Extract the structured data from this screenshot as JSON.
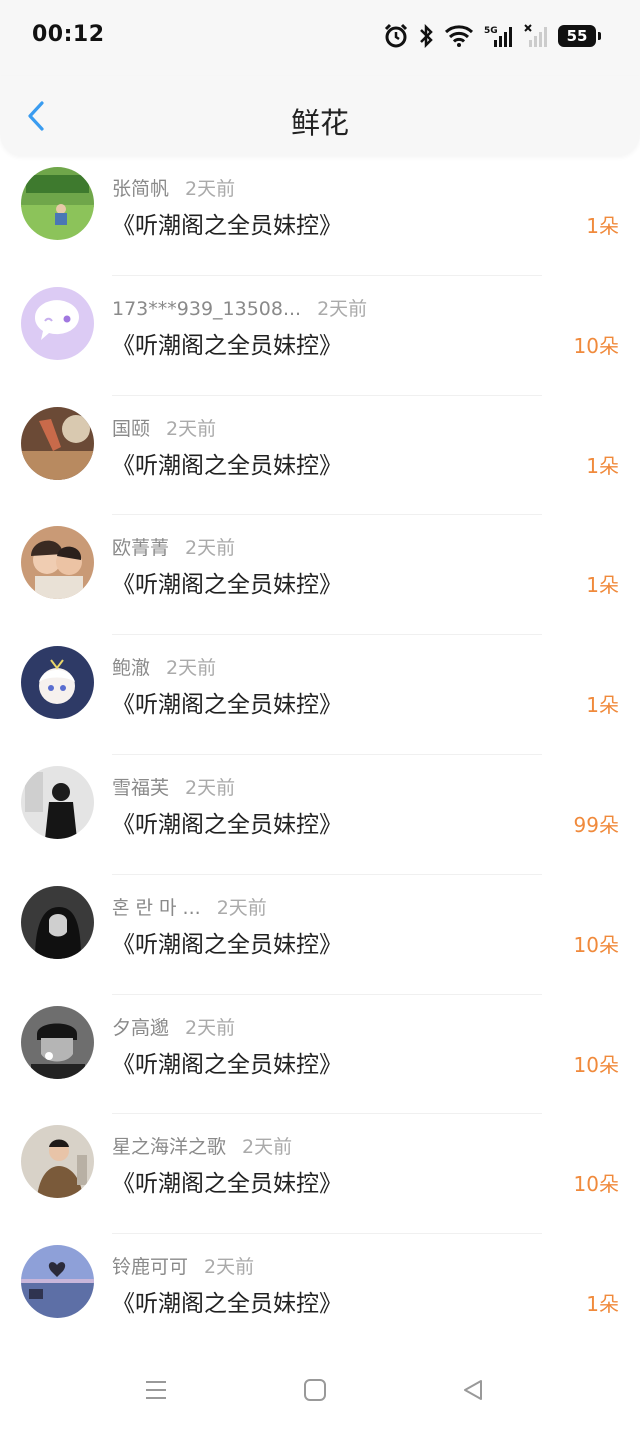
{
  "status_bar": {
    "time": "00:12",
    "battery": "55",
    "icons": [
      "alarm-icon",
      "bluetooth-icon",
      "wifi-icon",
      "5g-signal-icon",
      "signal-off-icon",
      "battery-icon"
    ]
  },
  "header": {
    "title": "鲜花",
    "back_icon": "chevron-left-icon",
    "accent_color": "#3a9cf0"
  },
  "list": {
    "count_color": "#f08a3c",
    "items": [
      {
        "name": "张简帆",
        "time": "2天前",
        "book": "《听潮阁之全员妹控》",
        "count": "1朵"
      },
      {
        "name": "173***939_13508...",
        "time": "2天前",
        "book": "《听潮阁之全员妹控》",
        "count": "10朵"
      },
      {
        "name": "国颐",
        "time": "2天前",
        "book": "《听潮阁之全员妹控》",
        "count": "1朵"
      },
      {
        "name": "欧菁菁",
        "time": "2天前",
        "book": "《听潮阁之全员妹控》",
        "count": "1朵"
      },
      {
        "name": "鲍澈",
        "time": "2天前",
        "book": "《听潮阁之全员妹控》",
        "count": "1朵"
      },
      {
        "name": "雪福芙",
        "time": "2天前",
        "book": "《听潮阁之全员妹控》",
        "count": "99朵"
      },
      {
        "name": "혼 란 마 ...",
        "time": "2天前",
        "book": "《听潮阁之全员妹控》",
        "count": "10朵"
      },
      {
        "name": "夕高邈",
        "time": "2天前",
        "book": "《听潮阁之全员妹控》",
        "count": "10朵"
      },
      {
        "name": "星之海洋之歌",
        "time": "2天前",
        "book": "《听潮阁之全员妹控》",
        "count": "10朵"
      },
      {
        "name": "铃鹿可可",
        "time": "2天前",
        "book": "《听潮阁之全员妹控》",
        "count": "1朵"
      }
    ]
  },
  "nav_bar": {
    "icons": [
      "menu-icon",
      "home-square-icon",
      "back-triangle-icon"
    ]
  }
}
